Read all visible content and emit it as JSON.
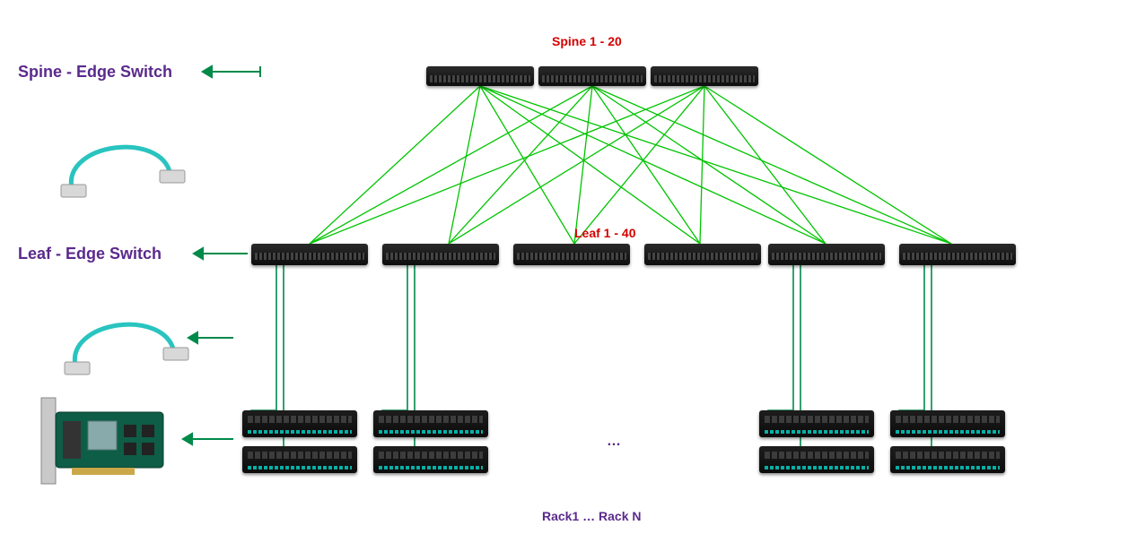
{
  "titles": {
    "spine_range": "Spine 1 - 20",
    "leaf_range": "Leaf 1 - 40",
    "racks": "Rack1 …  Rack N"
  },
  "side_labels": {
    "spine_edge": "Spine  - Edge Switch",
    "leaf_edge": "Leaf - Edge Switch"
  },
  "ellipsis": "…",
  "colors": {
    "link_spine_leaf": "#00c400",
    "link_leaf_server": "#008a4a",
    "arrow": "#008a4a",
    "label_red": "#d60000",
    "label_purple": "#5b2a8c",
    "cable_teal": "#29c4bf"
  },
  "topology": {
    "spine_switch_count_shown": 3,
    "leaf_switch_count_shown": 6,
    "rack_groups_shown": 4,
    "servers_per_group": 2
  }
}
